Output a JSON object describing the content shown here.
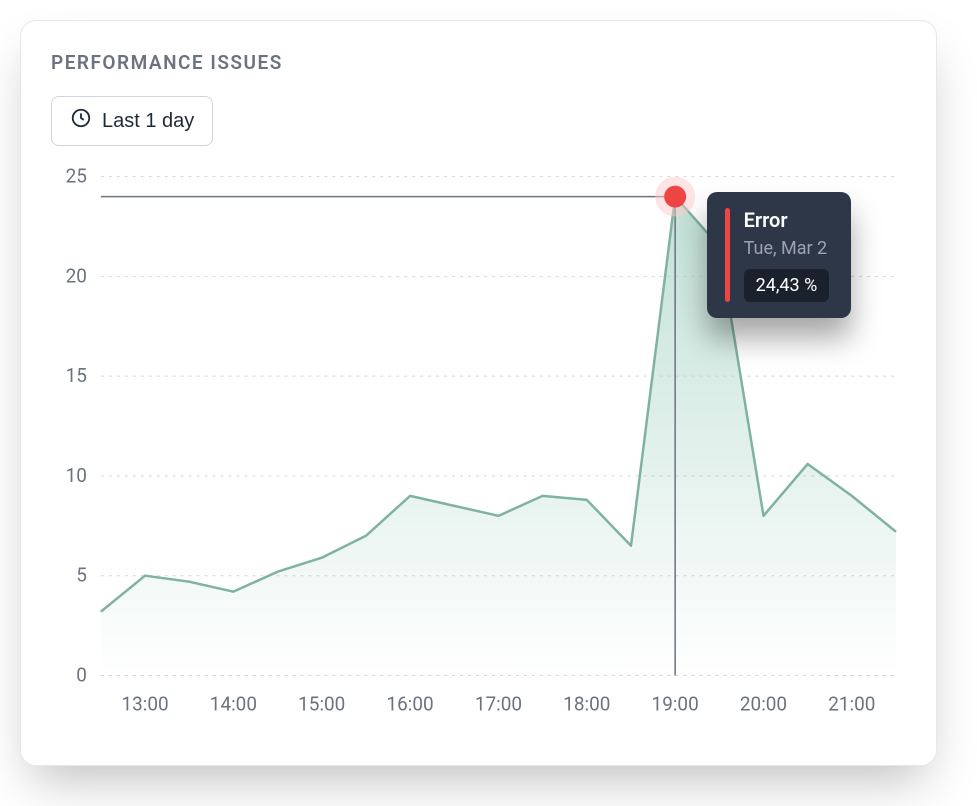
{
  "header": {
    "title": "PERFORMANCE ISSUES",
    "range_label": "Last 1 day"
  },
  "tooltip": {
    "title": "Error",
    "date": "Tue, Mar 2",
    "value": "24,43 %"
  },
  "chart_data": {
    "type": "area",
    "xlabel": "",
    "ylabel": "",
    "ylim": [
      0,
      25
    ],
    "x_ticks": [
      "13:00",
      "14:00",
      "15:00",
      "16:00",
      "17:00",
      "18:00",
      "19:00",
      "20:00",
      "21:00"
    ],
    "y_ticks": [
      0,
      5,
      10,
      15,
      20,
      25
    ],
    "highlight_index": 13,
    "series": [
      {
        "name": "Error",
        "x": [
          "12:30",
          "13:00",
          "13:30",
          "14:00",
          "14:30",
          "15:00",
          "15:30",
          "16:00",
          "16:30",
          "17:00",
          "17:30",
          "18:00",
          "18:30",
          "19:00",
          "19:30",
          "20:00",
          "20:30",
          "21:00",
          "21:30"
        ],
        "values": [
          3.2,
          5.0,
          4.7,
          4.2,
          5.2,
          5.9,
          7.0,
          9.0,
          8.5,
          8.0,
          9.0,
          8.8,
          6.5,
          24.0,
          21.5,
          8.0,
          10.6,
          9.0,
          7.2
        ]
      }
    ]
  }
}
